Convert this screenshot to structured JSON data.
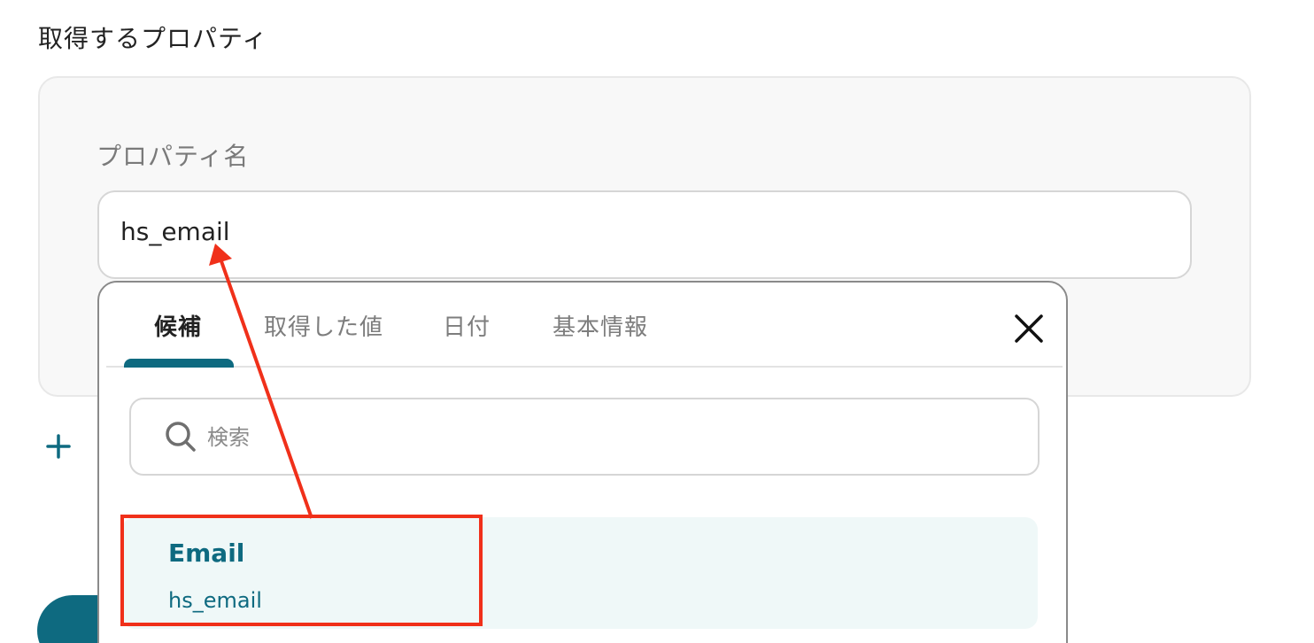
{
  "section_title": "取得するプロパティ",
  "property_field": {
    "label": "プロパティ名",
    "value": "hs_email"
  },
  "dropdown": {
    "tabs": [
      {
        "label": "候補",
        "active": true
      },
      {
        "label": "取得した値",
        "active": false
      },
      {
        "label": "日付",
        "active": false
      },
      {
        "label": "基本情報",
        "active": false
      }
    ],
    "search": {
      "placeholder": "検索"
    },
    "suggestions": [
      {
        "title": "Email",
        "subtitle": "hs_email"
      }
    ]
  },
  "colors": {
    "accent": "#0e6a80",
    "annotation": "#f0301a",
    "suggestion_bg": "#eff8f8"
  },
  "icons": {
    "add": "plus-icon",
    "close": "close-icon",
    "search": "search-icon"
  }
}
